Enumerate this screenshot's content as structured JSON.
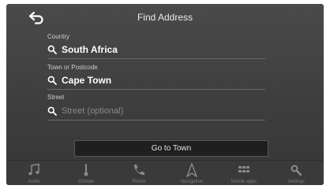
{
  "header": {
    "title": "Find Address",
    "back_icon": "back-arrow-icon"
  },
  "fields": {
    "country": {
      "label": "Country",
      "value": "South Africa"
    },
    "town": {
      "label": "Town or Postcode",
      "value": "Cape Town"
    },
    "street": {
      "label": "Street",
      "placeholder": "Street (optional)"
    }
  },
  "go_button": {
    "label": "Go to Town"
  },
  "nav": [
    {
      "label": "Audio",
      "icon": "music-note-icon"
    },
    {
      "label": "Climate",
      "icon": "climate-icon"
    },
    {
      "label": "Phone",
      "icon": "phone-icon"
    },
    {
      "label": "Navigation",
      "icon": "navigation-icon"
    },
    {
      "label": "Mobile apps",
      "icon": "apps-grid-icon"
    },
    {
      "label": "Settings",
      "icon": "settings-icon"
    }
  ],
  "colors": {
    "accent": "#ffffff",
    "background": "#444444"
  }
}
